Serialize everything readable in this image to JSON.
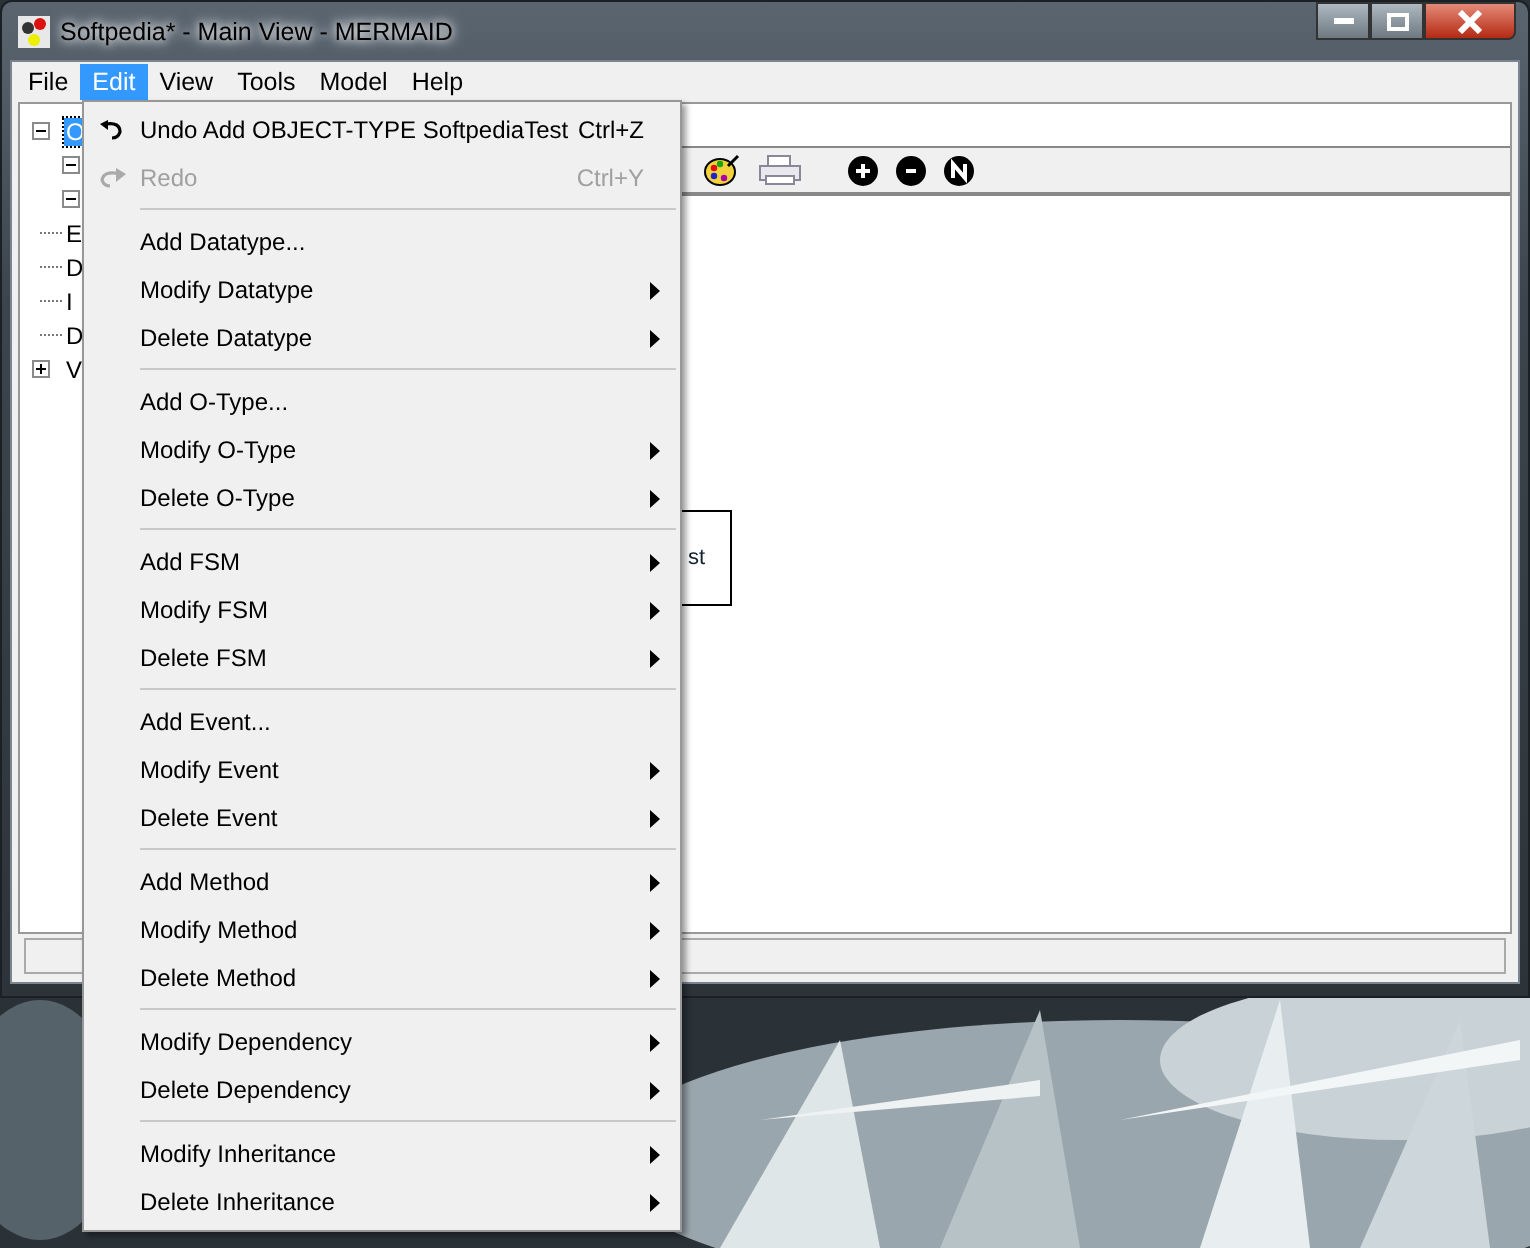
{
  "window": {
    "title": "Softpedia* - Main View - MERMAID"
  },
  "menubar": [
    {
      "label": "File",
      "selected": false
    },
    {
      "label": "Edit",
      "selected": true
    },
    {
      "label": "View",
      "selected": false
    },
    {
      "label": "Tools",
      "selected": false
    },
    {
      "label": "Model",
      "selected": false
    },
    {
      "label": "Help",
      "selected": false
    }
  ],
  "tree": [
    {
      "label": "O",
      "selected": true,
      "expanded": true,
      "children": [
        {
          "expanded": true
        },
        {
          "expanded": true
        },
        {
          "label": "E"
        },
        {
          "label": "D"
        },
        {
          "label": "I"
        },
        {
          "label": "D"
        }
      ]
    },
    {
      "label": "V",
      "selected": false,
      "expanded": false
    }
  ],
  "diagram": {
    "node_text": "st"
  },
  "edit_menu": [
    {
      "kind": "command",
      "label": "Undo Add OBJECT-TYPE SoftpediaTest",
      "shortcut": "Ctrl+Z",
      "disabled": false
    },
    {
      "kind": "command",
      "label": "Redo",
      "shortcut": "Ctrl+Y",
      "disabled": true
    },
    {
      "kind": "separator"
    },
    {
      "kind": "command",
      "label": "Add Datatype...",
      "disabled": false
    },
    {
      "kind": "submenu",
      "label": "Modify Datatype"
    },
    {
      "kind": "submenu",
      "label": "Delete Datatype"
    },
    {
      "kind": "separator"
    },
    {
      "kind": "command",
      "label": "Add O-Type...",
      "disabled": false
    },
    {
      "kind": "submenu",
      "label": "Modify O-Type"
    },
    {
      "kind": "submenu",
      "label": "Delete O-Type"
    },
    {
      "kind": "separator"
    },
    {
      "kind": "submenu",
      "label": "Add FSM"
    },
    {
      "kind": "submenu",
      "label": "Modify FSM"
    },
    {
      "kind": "submenu",
      "label": "Delete FSM"
    },
    {
      "kind": "separator"
    },
    {
      "kind": "command",
      "label": "Add Event...",
      "disabled": false
    },
    {
      "kind": "submenu",
      "label": "Modify Event"
    },
    {
      "kind": "submenu",
      "label": "Delete Event"
    },
    {
      "kind": "separator"
    },
    {
      "kind": "submenu",
      "label": "Add Method"
    },
    {
      "kind": "submenu",
      "label": "Modify Method"
    },
    {
      "kind": "submenu",
      "label": "Delete Method"
    },
    {
      "kind": "separator"
    },
    {
      "kind": "submenu",
      "label": "Modify Dependency"
    },
    {
      "kind": "submenu",
      "label": "Delete Dependency"
    },
    {
      "kind": "separator"
    },
    {
      "kind": "submenu",
      "label": "Modify Inheritance"
    },
    {
      "kind": "submenu",
      "label": "Delete Inheritance"
    }
  ]
}
